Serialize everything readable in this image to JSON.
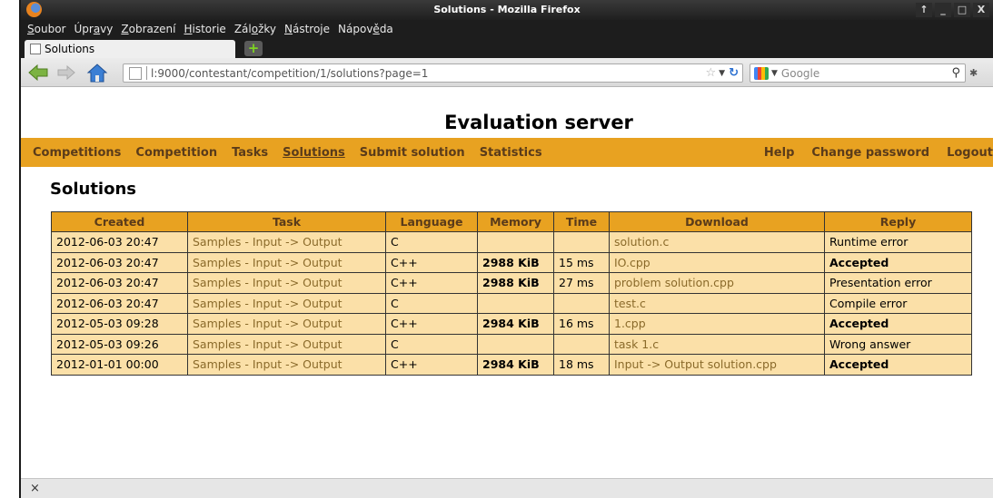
{
  "window": {
    "title": "Solutions - Mozilla Firefox",
    "controls": [
      "↑",
      "_",
      "□",
      "X"
    ]
  },
  "menu": [
    {
      "pre": "",
      "key": "S",
      "post": "oubor"
    },
    {
      "pre": "Úpr",
      "key": "a",
      "post": "vy"
    },
    {
      "pre": "",
      "key": "Z",
      "post": "obrazení"
    },
    {
      "pre": "",
      "key": "H",
      "post": "istorie"
    },
    {
      "pre": "Zál",
      "key": "o",
      "post": "žky"
    },
    {
      "pre": "",
      "key": "N",
      "post": "ástroje"
    },
    {
      "pre": "Nápov",
      "key": "ě",
      "post": "da"
    }
  ],
  "tab": {
    "label": "Solutions",
    "new_tab": "+"
  },
  "navbar": {
    "url": "l:9000/contestant/competition/1/solutions?page=1",
    "search_placeholder": "Google"
  },
  "site": {
    "title": "Evaluation server",
    "nav_left": [
      "Competitions",
      "Competition",
      "Tasks",
      "Solutions",
      "Submit solution",
      "Statistics"
    ],
    "nav_right": [
      "Help",
      "Change password",
      "Logout"
    ],
    "active": "Solutions"
  },
  "page": {
    "heading": "Solutions",
    "columns": [
      "Created",
      "Task",
      "Language",
      "Memory",
      "Time",
      "Download",
      "Reply"
    ],
    "rows": [
      {
        "created": "2012-06-03 20:47",
        "task": "Samples - Input -> Output",
        "language": "C",
        "memory": "",
        "time": "",
        "download": "solution.c",
        "reply": "Runtime error",
        "accepted": false
      },
      {
        "created": "2012-06-03 20:47",
        "task": "Samples - Input -> Output",
        "language": "C++",
        "memory": "2988 KiB",
        "time": "15 ms",
        "download": "IO.cpp",
        "reply": "Accepted",
        "accepted": true
      },
      {
        "created": "2012-06-03 20:47",
        "task": "Samples - Input -> Output",
        "language": "C++",
        "memory": "2988 KiB",
        "time": "27 ms",
        "download": "problem solution.cpp",
        "reply": "Presentation error",
        "accepted": false
      },
      {
        "created": "2012-06-03 20:47",
        "task": "Samples - Input -> Output",
        "language": "C",
        "memory": "",
        "time": "",
        "download": "test.c",
        "reply": "Compile error",
        "accepted": false
      },
      {
        "created": "2012-05-03 09:28",
        "task": "Samples - Input -> Output",
        "language": "C++",
        "memory": "2984 KiB",
        "time": "16 ms",
        "download": "1.cpp",
        "reply": "Accepted",
        "accepted": true
      },
      {
        "created": "2012-05-03 09:26",
        "task": "Samples - Input -> Output",
        "language": "C",
        "memory": "",
        "time": "",
        "download": "task 1.c",
        "reply": "Wrong answer",
        "accepted": false
      },
      {
        "created": "2012-01-01 00:00",
        "task": "Samples - Input -> Output",
        "language": "C++",
        "memory": "2984 KiB",
        "time": "18 ms",
        "download": "Input -> Output solution.cpp",
        "reply": "Accepted",
        "accepted": true
      }
    ]
  },
  "statusbar": {
    "close": "×"
  }
}
